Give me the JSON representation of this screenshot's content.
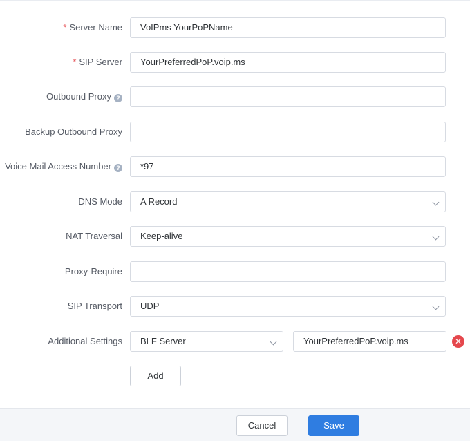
{
  "form": {
    "server_name": {
      "label": "Server Name",
      "required": "*",
      "value": "VoIPms YourPoPName"
    },
    "sip_server": {
      "label": "SIP Server",
      "required": "*",
      "value": "YourPreferredPoP.voip.ms"
    },
    "outbound_proxy": {
      "label": "Outbound Proxy",
      "value": ""
    },
    "backup_outbound_proxy": {
      "label": "Backup Outbound Proxy",
      "value": ""
    },
    "voice_mail_access_number": {
      "label": "Voice Mail Access Number",
      "value": "*97"
    },
    "dns_mode": {
      "label": "DNS Mode",
      "value": "A Record"
    },
    "nat_traversal": {
      "label": "NAT Traversal",
      "value": "Keep-alive"
    },
    "proxy_require": {
      "label": "Proxy-Require",
      "value": ""
    },
    "sip_transport": {
      "label": "SIP Transport",
      "value": "UDP"
    },
    "additional_settings": {
      "label": "Additional Settings",
      "key": "BLF Server",
      "value": "YourPreferredPoP.voip.ms",
      "add_label": "Add"
    }
  },
  "footer": {
    "cancel_label": "Cancel",
    "save_label": "Save"
  },
  "icons": {
    "help": "question-circle-icon",
    "remove": "close-circle-icon",
    "dropdown": "chevron-down-icon"
  },
  "colors": {
    "required": "#e5484d",
    "primary": "#2f7de1",
    "remove": "#e5484d"
  }
}
